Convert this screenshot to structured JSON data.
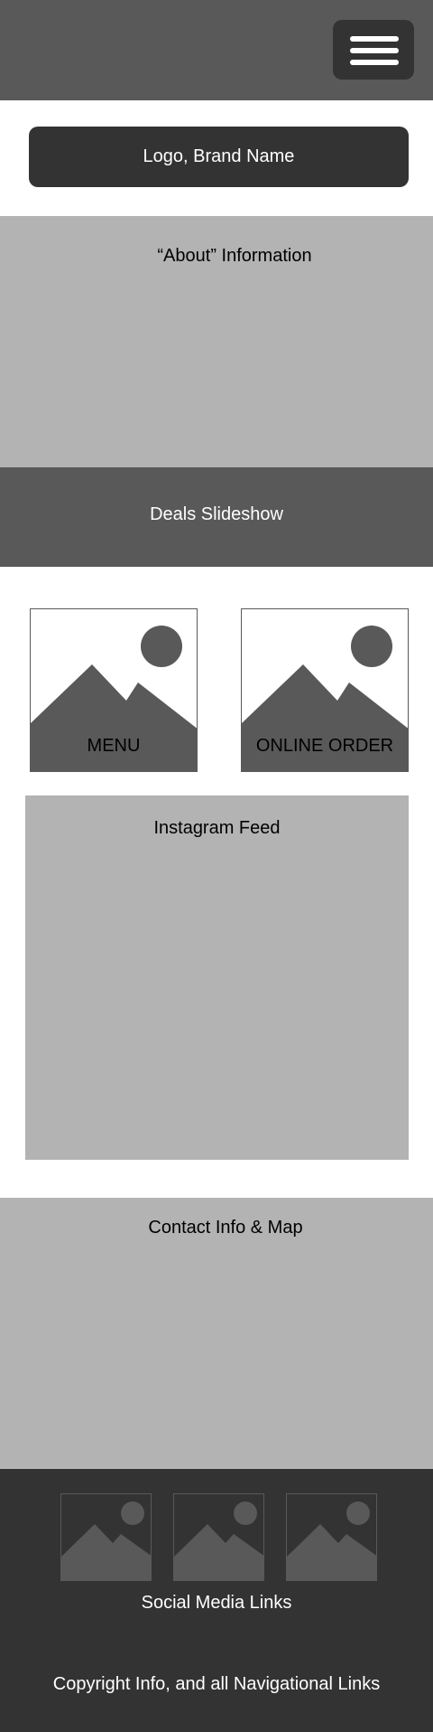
{
  "header": {
    "menu_icon": "hamburger-menu-icon"
  },
  "logo": {
    "label": "Logo, Brand Name"
  },
  "about": {
    "label": "“About” Information"
  },
  "deals": {
    "label": "Deals Slideshow"
  },
  "cards": [
    {
      "label": "MENU",
      "icon": "image-placeholder-icon"
    },
    {
      "label": "ONLINE ORDER",
      "icon": "image-placeholder-icon"
    }
  ],
  "instagram": {
    "label": "Instagram Feed"
  },
  "contact": {
    "label": "Contact Info & Map"
  },
  "footer": {
    "social_label": "Social Media Links",
    "social_icons": [
      "image-placeholder-icon",
      "image-placeholder-icon",
      "image-placeholder-icon"
    ],
    "copyright": "Copyright Info, and all Navigational Links"
  },
  "colors": {
    "dark": "#333333",
    "mid": "#595959",
    "light": "#b3b3b3",
    "white": "#ffffff"
  }
}
